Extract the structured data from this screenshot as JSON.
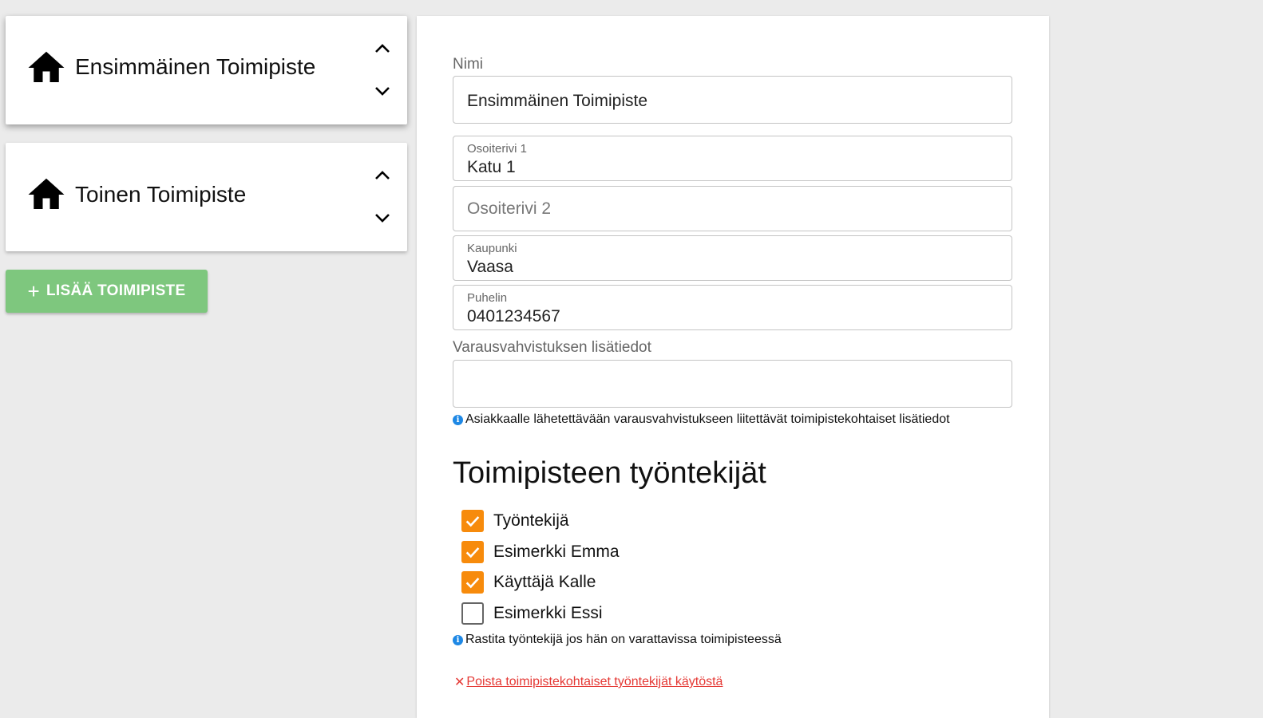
{
  "locations": [
    {
      "name": "Ensimmäinen Toimipiste",
      "icon": "house-icon"
    },
    {
      "name": "Toinen Toimipiste",
      "icon": "house-icon"
    }
  ],
  "add_button": {
    "icon": "plus-icon",
    "label": "LISÄÄ TOIMIPISTE",
    "color": "#7ec77e"
  },
  "form": {
    "name_label": "Nimi",
    "name_value": "Ensimmäinen Toimipiste",
    "address1_label": "Osoiterivi 1",
    "address1_value": "Katu 1",
    "address2_placeholder": "Osoiterivi 2",
    "city_label": "Kaupunki",
    "city_value": "Vaasa",
    "phone_label": "Puhelin",
    "phone_value": "0401234567",
    "extra_label": "Varausvahvistuksen lisätiedot",
    "extra_value": "",
    "extra_help": "Asiakkaalle lähetettävään varausvahvistukseen liitettävät toimipistekohtaiset lisätiedot"
  },
  "employees": {
    "title": "Toimipisteen työntekijät",
    "items": [
      {
        "name": "Työntekijä",
        "checked": true
      },
      {
        "name": "Esimerkki Emma",
        "checked": true
      },
      {
        "name": "Käyttäjä Kalle",
        "checked": true
      },
      {
        "name": "Esimerkki Essi",
        "checked": false
      }
    ],
    "help": "Rastita työntekijä jos hän on varattavissa toimipisteessä",
    "remove_icon": "close-icon",
    "remove_link": "Poista toimipistekohtaiset työntekijät käytöstä"
  },
  "colors": {
    "accent": "#f78b0c",
    "info": "#1e88e5",
    "danger": "#e53935",
    "success": "#7ec77e"
  }
}
